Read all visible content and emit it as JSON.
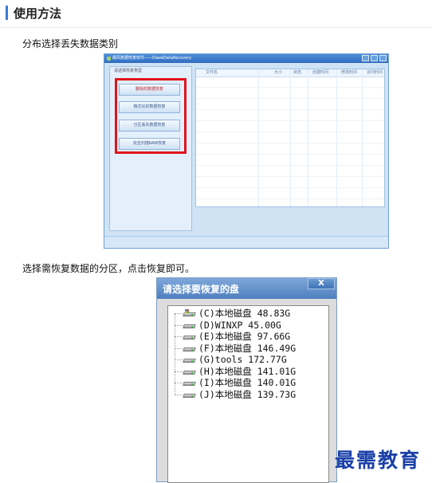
{
  "section": {
    "title": "使用方法"
  },
  "captions": {
    "step1": "分布选择丢失数据类别",
    "step2": "选择需恢复数据的分区，点击恢复即可。"
  },
  "app_window": {
    "title": "顺风数据恢复软件——DaewDataRecovery",
    "left_panel_label": "请选择恢复类型",
    "options": [
      "删除的数据恢复",
      "格式化的数据恢复",
      "分区丢失数据恢复",
      "完全扫描RAW恢复"
    ],
    "grid_columns": [
      "文件名",
      "大小",
      "状态",
      "创建时间",
      "修改时间",
      "访问时间"
    ]
  },
  "dialog": {
    "title": "请选择要恢复的盘",
    "close_label": "X",
    "drives": [
      {
        "label": "(C)本地磁盘 48.83G",
        "icon": "system-drive-icon"
      },
      {
        "label": "(D)WINXP 45.00G",
        "icon": "drive-icon"
      },
      {
        "label": "(E)本地磁盘 97.66G",
        "icon": "drive-icon"
      },
      {
        "label": "(F)本地磁盘 146.49G",
        "icon": "drive-icon"
      },
      {
        "label": "(G)tools 172.77G",
        "icon": "drive-icon"
      },
      {
        "label": "(H)本地磁盘 141.01G",
        "icon": "drive-icon"
      },
      {
        "label": "(I)本地磁盘 140.01G",
        "icon": "drive-icon"
      },
      {
        "label": "(J)本地磁盘 139.73G",
        "icon": "drive-icon"
      }
    ]
  },
  "watermark": "最需教育",
  "colors": {
    "accent": "#3a7bd5",
    "highlight": "#e2141b",
    "watermark": "#1a3fa8"
  }
}
